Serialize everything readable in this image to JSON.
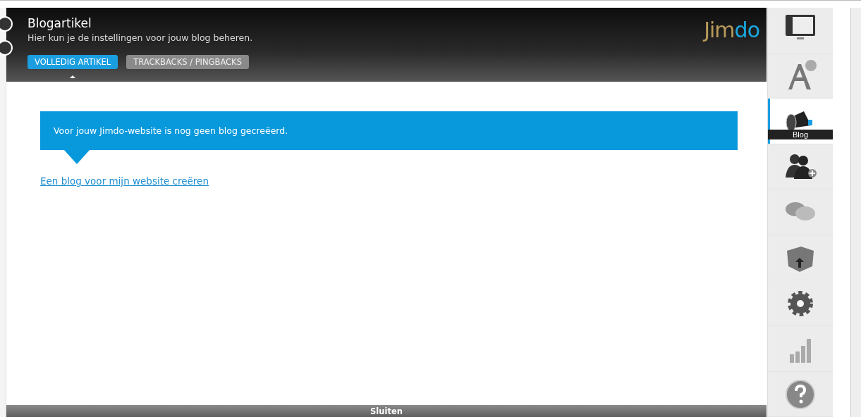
{
  "header": {
    "title": "Blogartikel",
    "subtitle": "Hier kun je de instellingen voor jouw blog beheren.",
    "logo": {
      "first": "Jim",
      "second": "do"
    }
  },
  "tabs": [
    {
      "label": "VOLLEDIG ARTIKEL",
      "selected": true
    },
    {
      "label": "TRACKBACKS / PINGBACKS",
      "selected": false
    }
  ],
  "notice": "Voor jouw Jimdo-website is nog geen blog gecreëerd.",
  "link": "Een blog voor mijn website creëren",
  "footer": {
    "close_label": "Sluiten"
  },
  "sidebar": {
    "items": [
      {
        "kind": "layout",
        "selected": false
      },
      {
        "kind": "style",
        "selected": false
      },
      {
        "kind": "blog",
        "selected": true,
        "label": "Blog"
      },
      {
        "kind": "users",
        "selected": false
      },
      {
        "kind": "comments",
        "selected": false
      },
      {
        "kind": "package",
        "selected": false
      },
      {
        "kind": "settings",
        "selected": false
      },
      {
        "kind": "statistics",
        "selected": false
      },
      {
        "kind": "help",
        "selected": false
      }
    ]
  }
}
